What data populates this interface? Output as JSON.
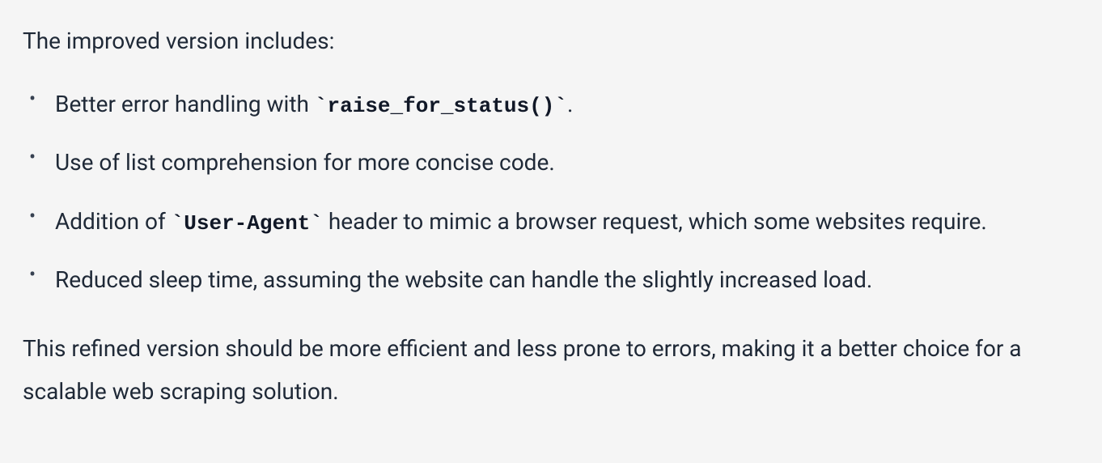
{
  "intro": "The improved version includes:",
  "items": [
    {
      "prefix": "Better error handling with ",
      "code": "`raise_for_status()`",
      "suffix": "."
    },
    {
      "prefix": "Use of list comprehension for more concise code.",
      "code": "",
      "suffix": ""
    },
    {
      "prefix": "Addition of ",
      "code": "`User-Agent`",
      "suffix": " header to mimic a browser request, which some websites require."
    },
    {
      "prefix": "Reduced sleep time, assuming the website can handle the slightly increased load.",
      "code": "",
      "suffix": ""
    }
  ],
  "conclusion": "This refined version should be more efficient and less prone to errors, making it a better choice for a scalable web scraping solution."
}
